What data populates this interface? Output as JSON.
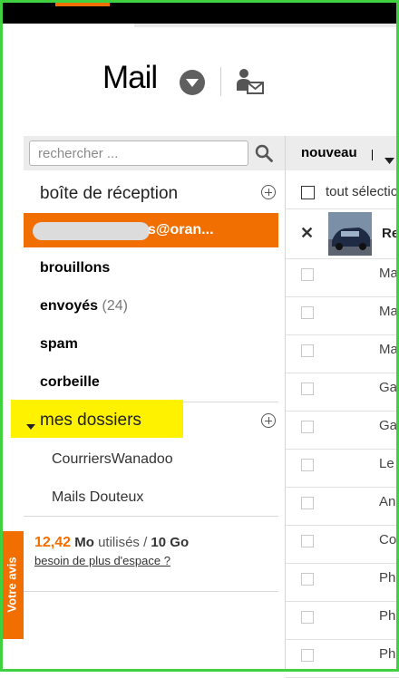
{
  "colors": {
    "accent": "#f16e00",
    "highlight": "#fff200",
    "frame": "#3fd13f"
  },
  "header": {
    "title": "Mail"
  },
  "search": {
    "placeholder": "rechercher ..."
  },
  "toolbar": {
    "new_label": "nouveau"
  },
  "sidebar": {
    "inbox": "boîte de réception",
    "account_suffix": "s@oran...",
    "folders": [
      {
        "label": "brouillons",
        "count": ""
      },
      {
        "label": "envoyés",
        "count": "(24)"
      },
      {
        "label": "spam",
        "count": ""
      },
      {
        "label": "corbeille",
        "count": ""
      }
    ],
    "my_folders": "mes dossiers",
    "subfolders": [
      "CourriersWanadoo",
      "Mails Douteux"
    ]
  },
  "storage": {
    "used": "12,42",
    "used_unit": "Mo",
    "used_label": "utilisés /",
    "total": "10 Go",
    "link": "besoin de plus d'espace ?"
  },
  "feedback": {
    "label": "Votre avis"
  },
  "messages": {
    "select_all": "tout sélectio",
    "first_sender": "Re",
    "rows": [
      "Ma",
      "Ma",
      "Ma",
      "Ga",
      "Ga",
      "Le",
      "An",
      "Co",
      "Ph",
      "Ph",
      "Ph"
    ]
  }
}
